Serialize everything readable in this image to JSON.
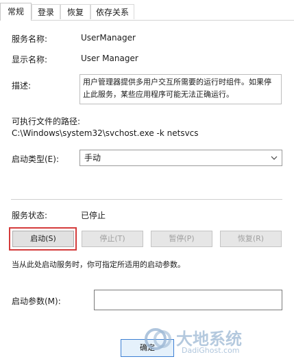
{
  "tabs": [
    {
      "label": "常规",
      "active": true
    },
    {
      "label": "登录"
    },
    {
      "label": "恢复"
    },
    {
      "label": "依存关系"
    }
  ],
  "fields": {
    "service_name_label": "服务名称:",
    "service_name_value": "UserManager",
    "display_name_label": "显示名称:",
    "display_name_value": "User Manager",
    "description_label": "描述:",
    "description_value": "用户管理器提供多用户交互所需要的运行时组件。如果停止此服务，某些应用程序可能无法正确运行。",
    "exec_path_label": "可执行文件的路径:",
    "exec_path_value": "C:\\Windows\\system32\\svchost.exe -k netsvcs",
    "startup_type_label": "启动类型(E):",
    "startup_type_value": "手动"
  },
  "status": {
    "label": "服务状态:",
    "value": "已停止"
  },
  "buttons": {
    "start": "启动(S)",
    "stop": "停止(T)",
    "pause": "暂停(P)",
    "resume": "恢复(R)",
    "ok": "确定"
  },
  "hint": "当从此处启动服务时，你可指定所适用的启动参数。",
  "start_params_label": "启动参数(M):",
  "start_params_value": "",
  "watermark": {
    "brand_cn": "大地系统",
    "brand_url": "DadiGhost.com"
  },
  "colors": {
    "highlight": "#d43b3b",
    "focus_border": "#3c7fd3",
    "watermark": "#9bb7d4"
  }
}
